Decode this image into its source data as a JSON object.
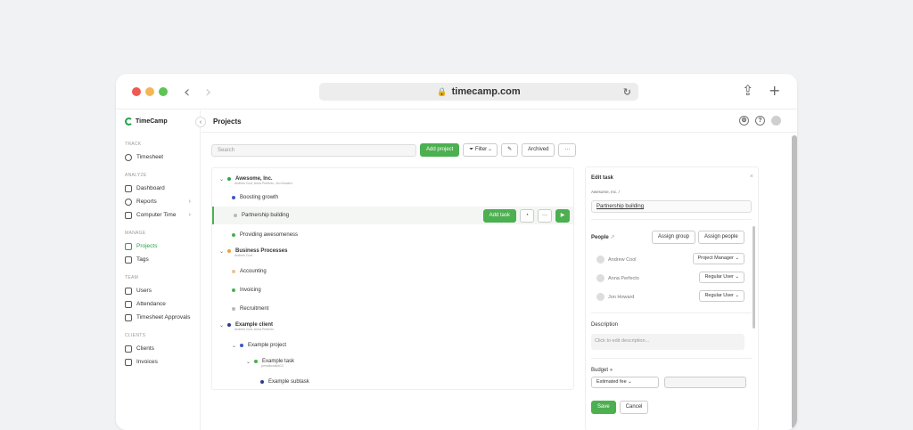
{
  "browser": {
    "url": "timecamp.com",
    "traffic_colors": [
      "#ee5a52",
      "#f5b657",
      "#5ec454"
    ]
  },
  "sidebar": {
    "brand": "TimeCamp",
    "sections": [
      {
        "label": "TRACK",
        "items": [
          {
            "label": "Timesheet",
            "icon": "clock-icon"
          }
        ]
      },
      {
        "label": "ANALYZE",
        "items": [
          {
            "label": "Dashboard",
            "icon": "dashboard-icon"
          },
          {
            "label": "Reports",
            "icon": "reports-icon"
          },
          {
            "label": "Computer Time",
            "icon": "computer-icon"
          }
        ]
      },
      {
        "label": "MANAGE",
        "items": [
          {
            "label": "Projects",
            "icon": "projects-icon",
            "active": true
          },
          {
            "label": "Tags",
            "icon": "tag-icon"
          }
        ]
      },
      {
        "label": "TEAM",
        "items": [
          {
            "label": "Users",
            "icon": "users-icon"
          },
          {
            "label": "Attendance",
            "icon": "attendance-icon"
          },
          {
            "label": "Timesheet Approvals",
            "icon": "approvals-icon"
          }
        ]
      },
      {
        "label": "CLIENTS",
        "items": [
          {
            "label": "Clients",
            "icon": "clients-icon"
          },
          {
            "label": "Invoices",
            "icon": "invoices-icon"
          }
        ]
      }
    ]
  },
  "header": {
    "title": "Projects"
  },
  "toolbar": {
    "search_placeholder": "Search",
    "add_project": "Add project",
    "filter": "Filter",
    "archived": "Archived",
    "more": "···"
  },
  "tree": [
    {
      "name": "Awesome, Inc.",
      "sub": "Andrew Cool, Anna Perfecto, Jon Howard",
      "color": "#2aa84a",
      "level": 0
    },
    {
      "name": "Boosting growth",
      "color": "#3a56c8",
      "level": 1
    },
    {
      "name": "Partnership building",
      "color": "#b9b9b9",
      "level": 1,
      "selected": true
    },
    {
      "name": "Providing awesomeness",
      "color": "#4caf50",
      "level": 1
    },
    {
      "name": "Business Processes",
      "sub": "Andrew Cool",
      "color": "#f0a040",
      "level": 0
    },
    {
      "name": "Accounting",
      "color": "#f0c090",
      "level": 1
    },
    {
      "name": "Invoicing",
      "color": "#4caf50",
      "level": 1
    },
    {
      "name": "Recruitment",
      "color": "#b9b9b9",
      "level": 1
    },
    {
      "name": "Example client",
      "sub": "Andrew Cool, Anna Perfecto",
      "color": "#2e3a8c",
      "level": 0
    },
    {
      "name": "Example project",
      "color": "#3a56c8",
      "level": 1
    },
    {
      "name": "Example task",
      "sub": "jarmailowski#12",
      "color": "#4caf50",
      "level": 2
    },
    {
      "name": "Example subtask",
      "color": "#2e3a8c",
      "level": 3
    }
  ],
  "row_actions": {
    "add_task": "Add task"
  },
  "edit_task": {
    "title": "Edit task",
    "breadcrumb": "Awesome, Inc. /",
    "name_value": "Partnership building",
    "people_label": "People",
    "assign_group": "Assign group",
    "assign_people": "Assign people",
    "people": [
      {
        "name": "Andrew Cool",
        "role": "Project Manager"
      },
      {
        "name": "Anna Perfecto",
        "role": "Regular User"
      },
      {
        "name": "Jon Howard",
        "role": "Regular User"
      }
    ],
    "description_label": "Description",
    "description_placeholder": "Click to edit description...",
    "budget_label": "Budget",
    "budget_type": "Estimated fee",
    "save": "Save",
    "cancel": "Cancel"
  }
}
